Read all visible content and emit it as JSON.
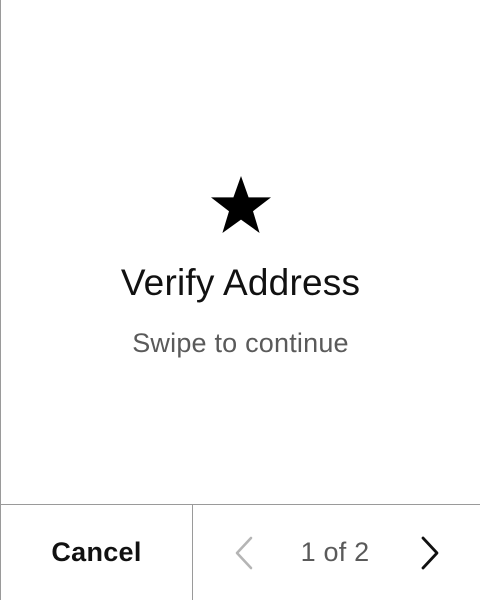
{
  "card": {
    "icon": "star-icon",
    "title": "Verify Address",
    "subtitle": "Swipe to continue"
  },
  "footer": {
    "cancel_label": "Cancel",
    "prev_icon": "chevron-left-icon",
    "next_icon": "chevron-right-icon",
    "page_indicator": "1 of 2",
    "current_page": 1,
    "total_pages": 2
  },
  "colors": {
    "background": "#ffffff",
    "text_primary": "#111111",
    "text_secondary": "#5a5a5a",
    "divider": "#9a9a9a",
    "prev_disabled": "#b5b5b5"
  }
}
